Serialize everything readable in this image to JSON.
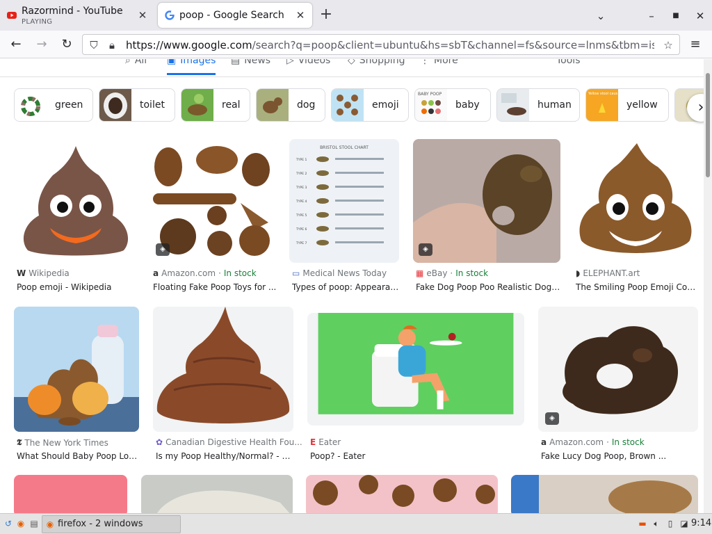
{
  "browser": {
    "tabs": [
      {
        "title": "Razormind - YouTube",
        "subtitle": "PLAYING"
      },
      {
        "title": "poop - Google Search"
      }
    ],
    "url_domain": "https://www.google.com",
    "url_rest": "/search?q=poop&client=ubuntu&hs=sbT&channel=fs&source=lnms&tbm=isch&sa="
  },
  "search_tabs": [
    "All",
    "Images",
    "News",
    "Videos",
    "Shopping",
    "More",
    "Tools"
  ],
  "chips": [
    "green",
    "toilet",
    "real",
    "dog",
    "emoji",
    "baby",
    "human",
    "yellow"
  ],
  "results_row1": [
    {
      "source": "Wikipedia",
      "stock": "",
      "caption": "Poop emoji - Wikipedia"
    },
    {
      "source": "Amazon.com",
      "stock": "In stock",
      "caption": "Floating Fake Poop Toys for ..."
    },
    {
      "source": "Medical News Today",
      "stock": "",
      "caption": "Types of poop: Appearan..."
    },
    {
      "source": "eBay",
      "stock": "In stock",
      "caption": "Fake Dog Poop Poo Realistic Dogg..."
    },
    {
      "source": "ELEPHANT.art",
      "stock": "",
      "caption": "The Smiling Poop Emoji Conv..."
    }
  ],
  "results_row2": [
    {
      "source": "The New York Times",
      "stock": "",
      "caption": "What Should Baby Poop Look..."
    },
    {
      "source": "Canadian Digestive Health Fou...",
      "stock": "",
      "caption": "Is my Poop Healthy/Normal? - Ca..."
    },
    {
      "source": "Eater",
      "stock": "",
      "caption": "Poop? - Eater"
    },
    {
      "source": "Amazon.com",
      "stock": "In stock",
      "caption": "Fake Lucy Dog Poop, Brown ..."
    }
  ],
  "stool_chart": {
    "title": "BRISTOL STOOL CHART",
    "types": [
      "TYPE 1",
      "TYPE 2",
      "TYPE 3",
      "TYPE 4",
      "TYPE 5",
      "TYPE 6",
      "TYPE 7"
    ]
  },
  "chip_card_text": {
    "baby_label": "BABY POOP",
    "yellow_label": "Yellow stool caus"
  },
  "taskbar": {
    "window_label": "firefox - 2 windows",
    "clock": "9:14"
  },
  "colors": {
    "accent": "#1a73e8",
    "stock": "#188038",
    "poop_brown": "#7a4a2a",
    "eater_green": "#5fcf60"
  }
}
